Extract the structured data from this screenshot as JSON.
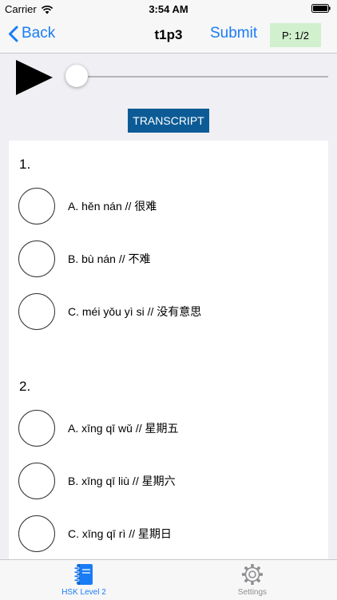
{
  "status_bar": {
    "carrier": "Carrier",
    "time": "3:54 AM",
    "icons": [
      "wifi-icon",
      "battery-icon"
    ]
  },
  "nav": {
    "back_label": "Back",
    "title": "t1p3",
    "submit_label": "Submit",
    "page_indicator": "P: 1/2"
  },
  "player": {
    "icon": "play-icon",
    "progress": 0
  },
  "transcript_label": "TRANSCRIPT",
  "questions": [
    {
      "number": "1.",
      "options": [
        {
          "label": "A. hěn nán // 很难",
          "selected": false
        },
        {
          "label": "B. bù nán // 不难",
          "selected": false
        },
        {
          "label": "C. méi yǒu yì si // 没有意思",
          "selected": false
        }
      ]
    },
    {
      "number": "2.",
      "options": [
        {
          "label": "A. xīng qī wǔ // 星期五",
          "selected": false
        },
        {
          "label": "B. xīng qī liù // 星期六",
          "selected": false
        },
        {
          "label": "C. xīng qī rì // 星期日",
          "selected": false
        }
      ]
    }
  ],
  "tab_bar": {
    "tabs": [
      {
        "label": "HSK Level 2",
        "icon": "notebook-icon",
        "active": true
      },
      {
        "label": "Settings",
        "icon": "gear-icon",
        "active": false
      }
    ]
  },
  "colors": {
    "accent": "#1a7cf5",
    "transcript_bg": "#0c5b96",
    "page_badge_bg": "#d1f0cd",
    "background": "#efeff4"
  }
}
